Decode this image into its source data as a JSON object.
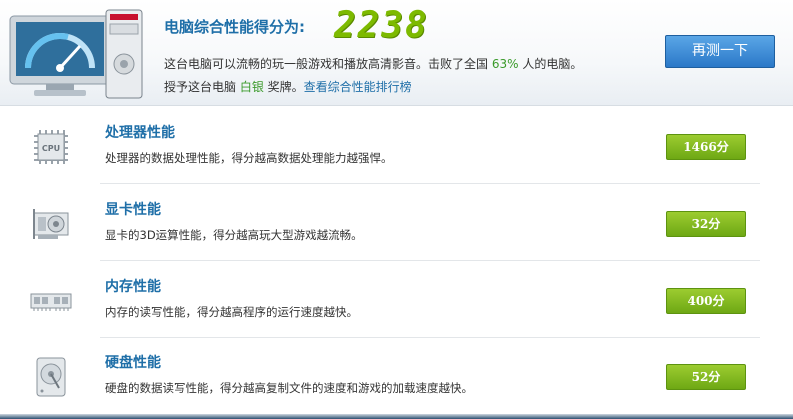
{
  "header": {
    "score_title": "电脑综合性能得分为:",
    "score_value": "2238",
    "desc1_prefix": "这台电脑可以流畅的玩一般游戏和播放高清影音。击败了全国 ",
    "desc1_percent": "63%",
    "desc1_suffix": " 人的电脑。",
    "desc2_prefix": "授予这台电脑 ",
    "desc2_medal": "白银",
    "desc2_suffix": " 奖牌。",
    "rank_link": "查看综合性能排行榜",
    "retest_label": "再测一下"
  },
  "items": [
    {
      "name": "处理器性能",
      "detail": "处理器的数据处理性能，得分越高数据处理能力越强悍。",
      "score": "1466分",
      "icon": "cpu-icon"
    },
    {
      "name": "显卡性能",
      "detail": "显卡的3D运算性能，得分越高玩大型游戏越流畅。",
      "score": "32分",
      "icon": "graphics-card-icon"
    },
    {
      "name": "内存性能",
      "detail": "内存的读写性能，得分越高程序的运行速度越快。",
      "score": "400分",
      "icon": "memory-icon"
    },
    {
      "name": "硬盘性能",
      "detail": "硬盘的数据读写性能，得分越高复制文件的速度和游戏的加载速度越快。",
      "score": "52分",
      "icon": "hard-disk-icon"
    }
  ],
  "colors": {
    "accent_blue": "#1f6fa8",
    "score_green": "#7dba00",
    "badge_green": "#6ea814"
  }
}
